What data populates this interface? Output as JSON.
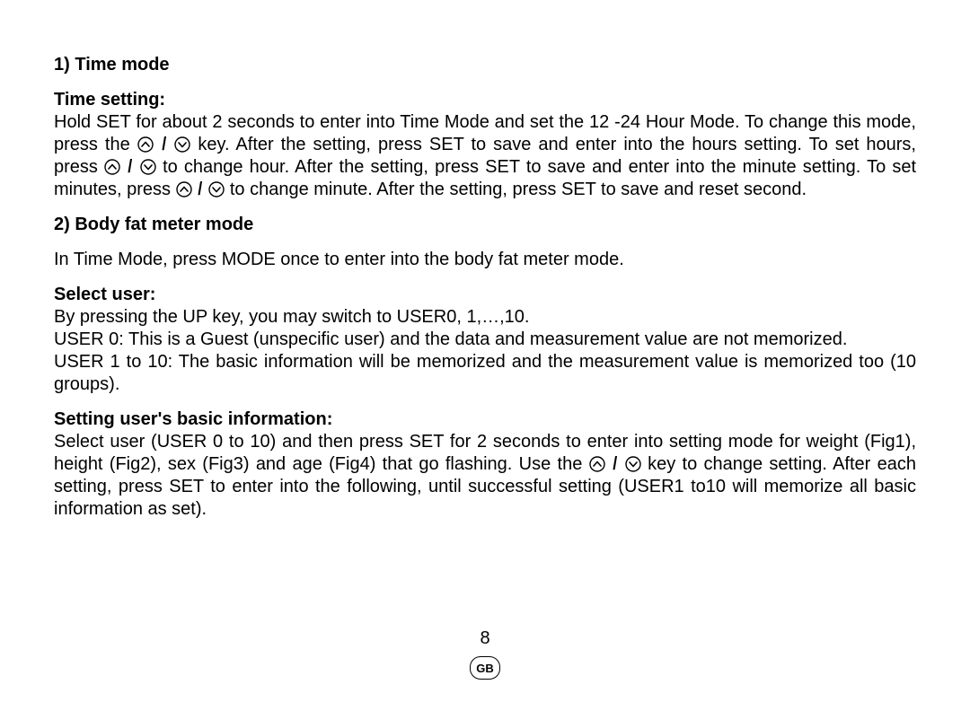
{
  "section1": {
    "heading": "1) Time mode",
    "sub": "Time setting:",
    "p1a": "Hold SET for about 2 seconds to enter into Time Mode and set the 12 -24 Hour Mode. To change this mode, press the ",
    "p1b": " key. After the setting, press SET to save and enter into the hours setting. To set hours, press ",
    "p1c": " to change hour. After the setting, press SET to save and enter into the minute setting. To set minutes, press ",
    "p1d": " to change minute. After the setting, press SET to save and reset second."
  },
  "section2": {
    "heading": "2) Body fat meter mode",
    "intro": "In Time Mode, press MODE once to enter into the body fat meter mode.",
    "sub1": "Select user:",
    "p1": "By pressing the UP key, you may switch to USER0, 1,…,10.",
    "p2": "USER 0: This is a Guest (unspecific user) and the data and measurement value are not memorized.",
    "p3": "USER 1 to 10: The basic information will be memorized and the measurement value is memorized too (10 groups).",
    "sub2": "Setting user's basic information:",
    "p4a": "Select user (USER 0 to 10) and then press SET for 2 seconds to enter into setting mode for weight (Fig1), height (Fig2), sex (Fig3) and age (Fig4) that go flashing. Use the ",
    "p4b": " key to change setting. After each setting, press SET to enter into the following, until successful setting (USER1 to10 will memorize all basic information as set)."
  },
  "footer": {
    "page": "8",
    "lang": "GB"
  },
  "icons": {
    "up": "up-chevron-icon",
    "down": "down-chevron-icon"
  }
}
